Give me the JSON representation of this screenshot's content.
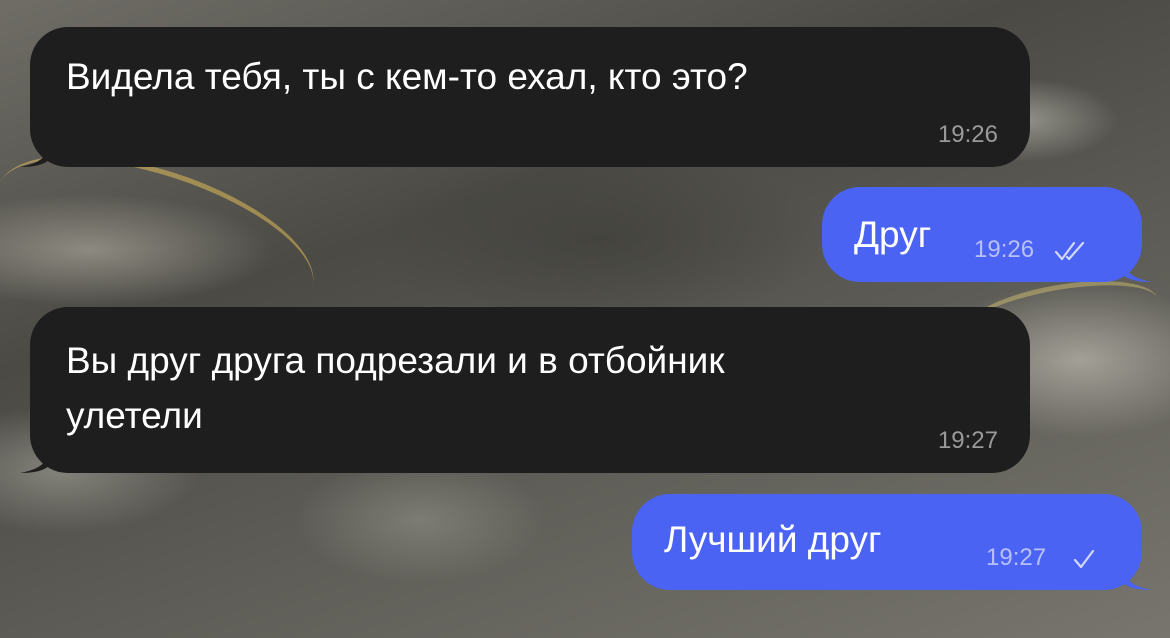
{
  "messages": [
    {
      "direction": "incoming",
      "text": "Видела тебя, ты с кем-то ехал, кто это?",
      "time": "19:26"
    },
    {
      "direction": "outgoing",
      "text": "Друг",
      "time": "19:26",
      "status": "read"
    },
    {
      "direction": "incoming",
      "text": "Вы друг друга подрезали и в отбойник\nулетели",
      "time": "19:27"
    },
    {
      "direction": "outgoing",
      "text": "Лучший друг",
      "time": "19:27",
      "status": "sent"
    }
  ],
  "colors": {
    "incoming_bubble": "#1e1e1e",
    "outgoing_bubble": "#4b63f2",
    "text": "#ffffff"
  },
  "icons": {
    "read_status": "double-check-icon",
    "sent_status": "check-icon"
  }
}
